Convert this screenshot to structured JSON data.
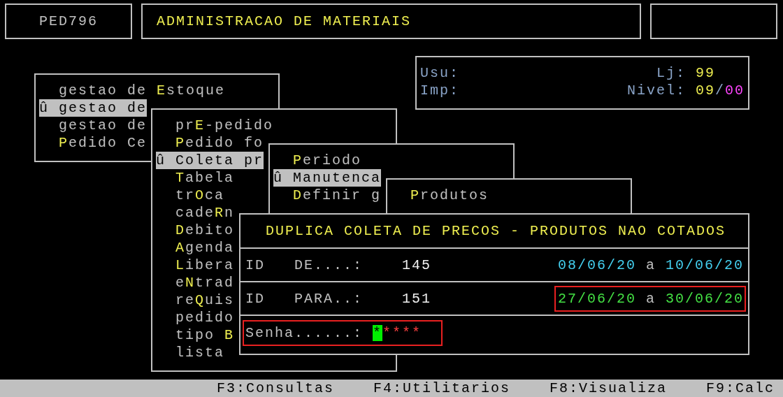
{
  "header": {
    "program": "PED796",
    "title": "ADMINISTRACAO DE MATERIAIS"
  },
  "info": {
    "user_label": "Usu:",
    "printer_label": "Imp:",
    "store_label": "Lj:",
    "store": "99",
    "nivel_label": "Nivel:",
    "nivel": {
      "first": "09",
      "separator": "/",
      "second": "00"
    }
  },
  "menus": [
    {
      "items": [
        {
          "before": "gestao de ",
          "key": "E",
          "after": "stoque",
          "selected": false
        },
        {
          "marker": "û",
          "before": "gestao de",
          "selected": true
        },
        {
          "before": "gestao de",
          "selected": false
        },
        {
          "key": "P",
          "after": "edido Ce",
          "selected": false
        }
      ]
    },
    {
      "items": [
        {
          "before": "pr",
          "key": "E",
          "after": "-pedido",
          "selected": false
        },
        {
          "key": "P",
          "after": "edido fo",
          "selected": false
        },
        {
          "marker": "û",
          "before": "Coleta pr",
          "selected": true
        },
        {
          "key": "T",
          "after": "abela",
          "selected": false
        },
        {
          "before": "tr",
          "key": "O",
          "after": "ca",
          "selected": false
        },
        {
          "before": "cade",
          "key": "R",
          "after": "n",
          "selected": false
        },
        {
          "key": "D",
          "after": "ebito",
          "selected": false
        },
        {
          "key": "A",
          "after": "genda",
          "selected": false
        },
        {
          "key": "L",
          "after": "ibera",
          "selected": false
        },
        {
          "before": "e",
          "key": "N",
          "after": "trad",
          "selected": false
        },
        {
          "before": "re",
          "key": "Q",
          "after": "uis",
          "selected": false
        },
        {
          "before": "pedido",
          "selected": false
        },
        {
          "before": "tipo ",
          "key": "B",
          "selected": false
        },
        {
          "before": "lista",
          "selected": false
        }
      ]
    },
    {
      "items": [
        {
          "key": "P",
          "after": "eriodo",
          "selected": false
        },
        {
          "marker": "û",
          "before": "Manutenca",
          "selected": true
        },
        {
          "key": "D",
          "after": "efinir g",
          "selected": false
        }
      ]
    },
    {
      "items": [
        {
          "key": "P",
          "after": "rodutos",
          "selected": false
        }
      ]
    }
  ],
  "dialog": {
    "title": "DUPLICA COLETA DE PRECOS - PRODUTOS NAO COTADOS",
    "rows": [
      {
        "id_label": "ID",
        "label": "DE....:",
        "value": "145",
        "date_from": "08/06/20",
        "separator": "a",
        "date_to": "10/06/20",
        "kind": "source",
        "annotated": false
      },
      {
        "id_label": "ID",
        "label": "PARA..:",
        "value": "151",
        "date_from": "27/06/20",
        "separator": "a",
        "date_to": "30/06/20",
        "kind": "target",
        "annotated": true
      }
    ],
    "password": {
      "label": "Senha......:",
      "cursor_char": "*",
      "rest": "****",
      "annotated": true
    }
  },
  "status_bar": [
    "F3:Consultas",
    "F4:Utilitarios",
    "F8:Visualiza",
    "F9:Calc"
  ]
}
